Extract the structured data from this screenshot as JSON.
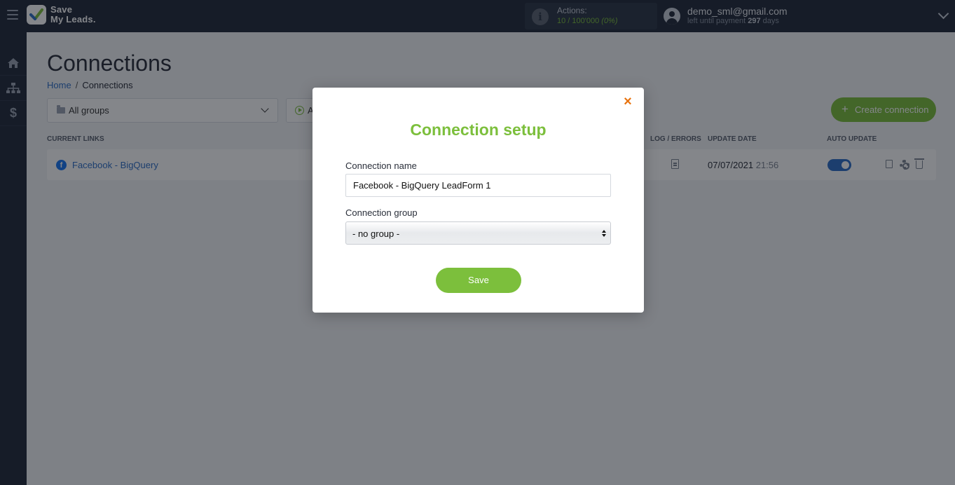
{
  "app": {
    "brand_line1": "Save",
    "brand_line2": "My Leads.",
    "accent_color": "#7cbf3c",
    "link_color": "#2f6fc7"
  },
  "topbar": {
    "actions_label": "Actions:",
    "actions_value": "10 / 100'000",
    "actions_percent": "(0%)",
    "user_email": "demo_sml@gmail.com",
    "payment_prefix": "left until payment",
    "payment_days": "297",
    "payment_suffix": "days"
  },
  "sidebar": {
    "items": [
      {
        "icon": "home-icon"
      },
      {
        "icon": "sitemap-icon"
      },
      {
        "icon": "dollar-icon"
      }
    ]
  },
  "page": {
    "title": "Connections",
    "breadcrumb": {
      "home": "Home",
      "separator": "/",
      "current": "Connections"
    },
    "group_filter": "All groups",
    "status_filter": "A",
    "create_button": "Create connection"
  },
  "table": {
    "headers": {
      "current_links": "CURRENT LINKS",
      "log_errors": "LOG / ERRORS",
      "update_date": "UPDATE DATE",
      "auto_update": "AUTO UPDATE"
    },
    "rows": [
      {
        "name": "Facebook - BigQuery",
        "date": "07/07/2021",
        "time": "21:56",
        "auto_update": true
      }
    ]
  },
  "modal": {
    "close_symbol": "×",
    "title": "Connection setup",
    "name_label": "Connection name",
    "name_value": "Facebook - BigQuery LeadForm 1",
    "group_label": "Connection group",
    "group_value": "- no group -",
    "save_label": "Save"
  }
}
